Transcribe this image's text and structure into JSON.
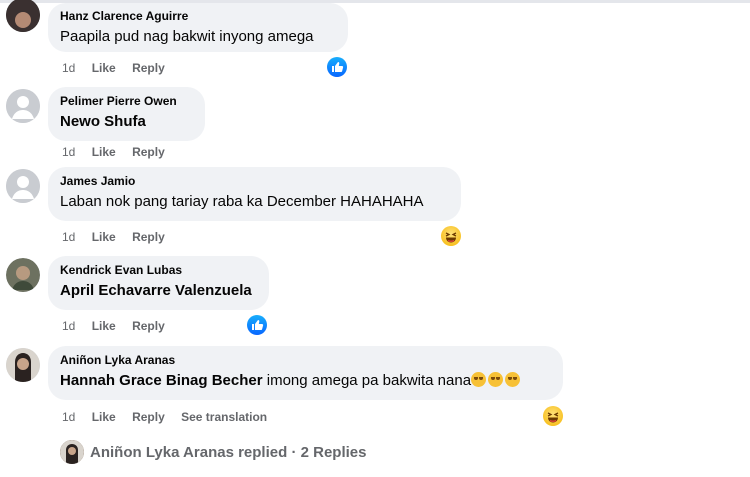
{
  "comments": [
    {
      "author": "Hanz Clarence Aguirre",
      "text": "Paapila pud nag bakwit inyong amega",
      "time": "1d",
      "like_label": "Like",
      "reply_label": "Reply",
      "reaction": "like-icon"
    },
    {
      "author": "Pelimer Pierre Owen",
      "mention": "Newo Shufa",
      "time": "1d",
      "like_label": "Like",
      "reply_label": "Reply"
    },
    {
      "author": "James Jamio",
      "text": "Laban nok pang tariay raba ka December HAHAHAHA",
      "time": "1d",
      "like_label": "Like",
      "reply_label": "Reply",
      "reaction": "haha-icon"
    },
    {
      "author": "Kendrick Evan Lubas",
      "mention": "April Echavarre Valenzuela",
      "time": "1d",
      "like_label": "Like",
      "reply_label": "Reply",
      "reaction": "like-icon"
    },
    {
      "author": "Aniñon Lyka Aranas",
      "mention": "Hannah Grace Binag Becher",
      "text": " imong amega pa bakwita nana",
      "emojis": "crying-face-icon",
      "time": "1d",
      "like_label": "Like",
      "reply_label": "Reply",
      "translate_label": "See translation",
      "reaction": "haha-icon"
    }
  ],
  "replies": {
    "label": "Aniñon Lyka Aranas replied · 2 Replies"
  },
  "colors": {
    "bubble": "#f0f2f5",
    "meta": "#65676b",
    "like_blue": "#0866ff",
    "haha_yellow": "#f7c136"
  }
}
